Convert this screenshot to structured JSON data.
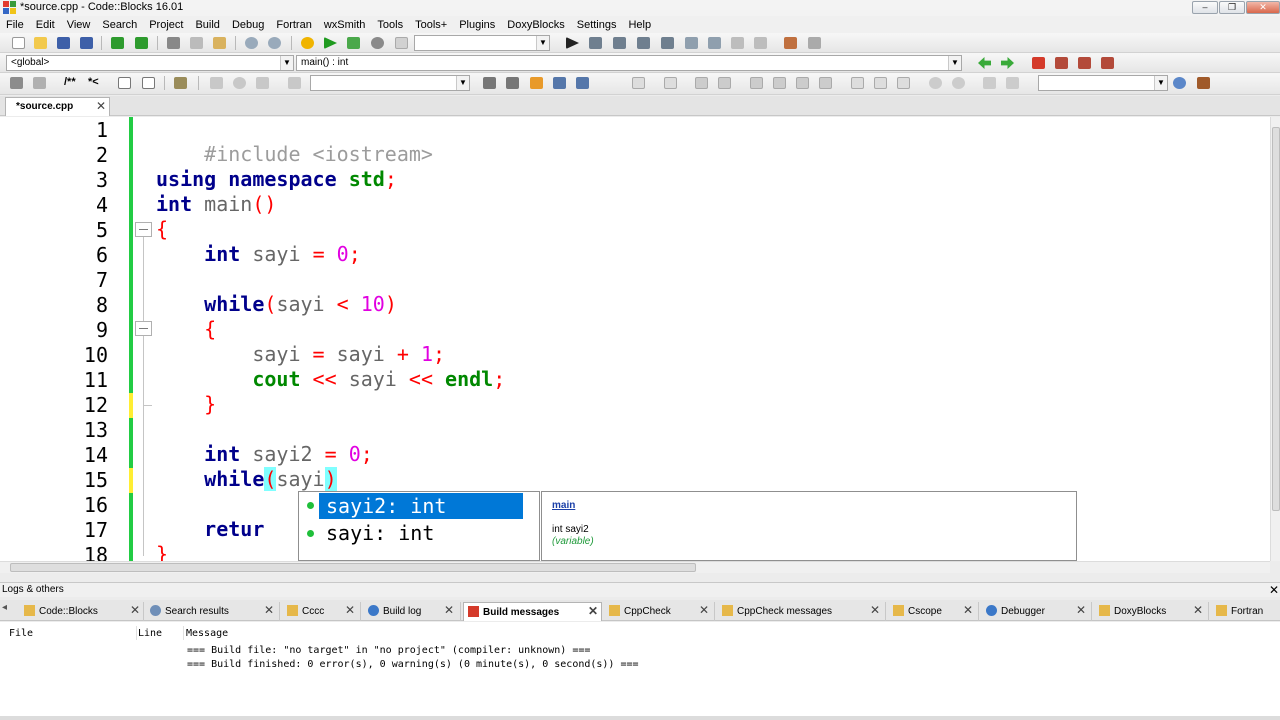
{
  "window": {
    "title": "*source.cpp - Code::Blocks 16.01",
    "minimize": "–",
    "maximize": "❐",
    "close": "✕"
  },
  "menu": [
    "File",
    "Edit",
    "View",
    "Search",
    "Project",
    "Build",
    "Debug",
    "Fortran",
    "wxSmith",
    "Tools",
    "Tools+",
    "Plugins",
    "DoxyBlocks",
    "Settings",
    "Help"
  ],
  "toolbar": {
    "scope_combo": "<global>",
    "function_combo": "main() : int",
    "target_combo": "",
    "search_combo": "",
    "comment_btn": "/**",
    "uncomment_btn": "*<"
  },
  "editor": {
    "tab_label": "*source.cpp",
    "tab_close": "✕",
    "line_numbers": [
      "1",
      "2",
      "3",
      "4",
      "5",
      "6",
      "7",
      "8",
      "9",
      "10",
      "11",
      "12",
      "13",
      "14",
      "15",
      "16",
      "17",
      "18"
    ],
    "code": {
      "l1": "#include <iostream>",
      "l3_kw1": "using",
      "l3_kw2": "namespace",
      "l3_id": "std",
      "l3_end": ";",
      "l4_type": "int",
      "l4_name": "main",
      "l4_parens": "()",
      "l5_brace": "{",
      "l6_type": "int",
      "l6_var": "sayi",
      "l6_eq": "=",
      "l6_num": "0",
      "l6_end": ";",
      "l8_kw": "while",
      "l8_open": "(",
      "l8_var": "sayi",
      "l8_op": "<",
      "l8_num": "10",
      "l8_close": ")",
      "l9_brace": "{",
      "l10_var": "sayi",
      "l10_eq": "=",
      "l10_var2": "sayi",
      "l10_op": "+",
      "l10_num": "1",
      "l10_end": ";",
      "l11_cout": "cout",
      "l11_op": "<<",
      "l11_var": "sayi",
      "l11_op2": "<<",
      "l11_endl": "endl",
      "l11_end": ";",
      "l12_brace": "}",
      "l14_type": "int",
      "l14_var": "sayi2",
      "l14_eq": "=",
      "l14_num": "0",
      "l14_end": ";",
      "l15_kw": "while",
      "l15_open": "(",
      "l15_var": "sayi",
      "l15_close": ")",
      "l17_kw": "retur",
      "l18_brace": "}"
    }
  },
  "autocomplete": {
    "items": [
      "sayi2: int",
      "sayi: int"
    ],
    "selected_index": 0,
    "doc_title": "main",
    "doc_decl": "int sayi2",
    "doc_kind": "(variable)"
  },
  "logs": {
    "title": "Logs & others",
    "close": "✕",
    "tabs": [
      {
        "label": "Code::Blocks",
        "active": false
      },
      {
        "label": "Search results",
        "active": false
      },
      {
        "label": "Cccc",
        "active": false
      },
      {
        "label": "Build log",
        "active": false
      },
      {
        "label": "Build messages",
        "active": true
      },
      {
        "label": "CppCheck",
        "active": false
      },
      {
        "label": "CppCheck messages",
        "active": false
      },
      {
        "label": "Cscope",
        "active": false
      },
      {
        "label": "Debugger",
        "active": false
      },
      {
        "label": "DoxyBlocks",
        "active": false
      },
      {
        "label": "Fortran",
        "active": false
      }
    ],
    "tab_close": "✕",
    "columns": [
      "File",
      "Line",
      "Message"
    ],
    "messages": [
      "=== Build file: \"no target\" in \"no project\" (compiler: unknown) ===",
      "=== Build finished: 0 error(s), 0 warning(s) (0 minute(s), 0 second(s)) ==="
    ]
  },
  "colors": {
    "keyword": "#00008b",
    "green_keyword": "#008800",
    "operator": "#ff0000",
    "number": "#e100e1",
    "preprocessor": "#9c9c9c",
    "bracket_highlight": "#80ffff",
    "change_saved": "#22cc44",
    "change_unsaved": "#ffee33",
    "selection": "#0078d7"
  }
}
